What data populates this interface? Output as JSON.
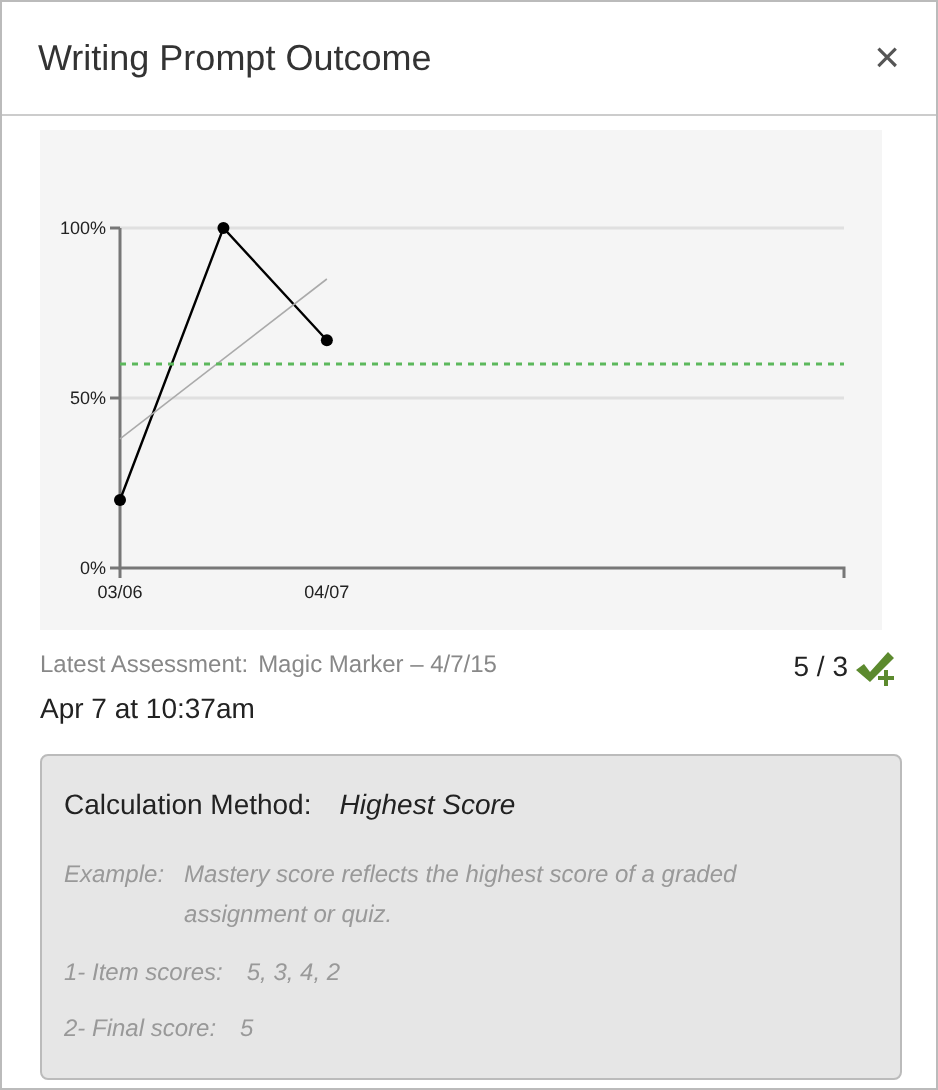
{
  "dialog": {
    "title": "Writing Prompt Outcome",
    "close": "×"
  },
  "chart_data": {
    "type": "line",
    "categories": [
      "03/06",
      null,
      "04/07",
      null,
      null,
      null,
      null,
      null
    ],
    "ylim": [
      0,
      100
    ],
    "yticks": [
      {
        "value": 0,
        "label": "0%"
      },
      {
        "value": 50,
        "label": "50%"
      },
      {
        "value": 100,
        "label": "100%"
      }
    ],
    "series": [
      {
        "color": "#000000",
        "marker": "o",
        "values": [
          20,
          100,
          67,
          null,
          null,
          null,
          null,
          null
        ]
      },
      {
        "color": "#aaaaaa",
        "values": [
          38,
          61.5,
          85,
          null,
          null,
          null,
          null,
          null
        ]
      },
      {
        "color": "#5cb85c",
        "line_style": "dashed",
        "values": [
          60,
          60,
          60,
          60,
          60,
          60,
          60,
          60
        ]
      }
    ]
  },
  "assessment": {
    "label": "Latest Assessment:",
    "name": "Magic Marker – 4/7/15",
    "score": "5 / 3",
    "date": "Apr 7 at 10:37am"
  },
  "calculation": {
    "label": "Calculation Method:",
    "method": "Highest Score",
    "example_label": "Example:",
    "example": "Mastery score reflects the highest score of a graded assignment or quiz.",
    "steps": [
      {
        "label": "1- Item scores:",
        "value": "5, 3, 4, 2"
      },
      {
        "label": "2- Final score:",
        "value": "5"
      }
    ]
  }
}
